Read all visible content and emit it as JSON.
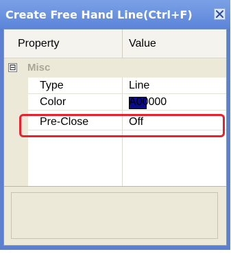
{
  "window": {
    "title": "Create Free Hand Line(Ctrl+F)"
  },
  "grid": {
    "header": {
      "property": "Property",
      "value": "Value"
    },
    "category": {
      "expander": "⊟",
      "label": "Misc"
    },
    "rows": [
      {
        "name": "Type",
        "value": "Line"
      },
      {
        "name": "Color",
        "value": "A00000",
        "swatch_color": "#0a0a8c"
      },
      {
        "name": "Pre-Close",
        "value": "Off"
      }
    ]
  },
  "highlight_color": "#e8212e"
}
